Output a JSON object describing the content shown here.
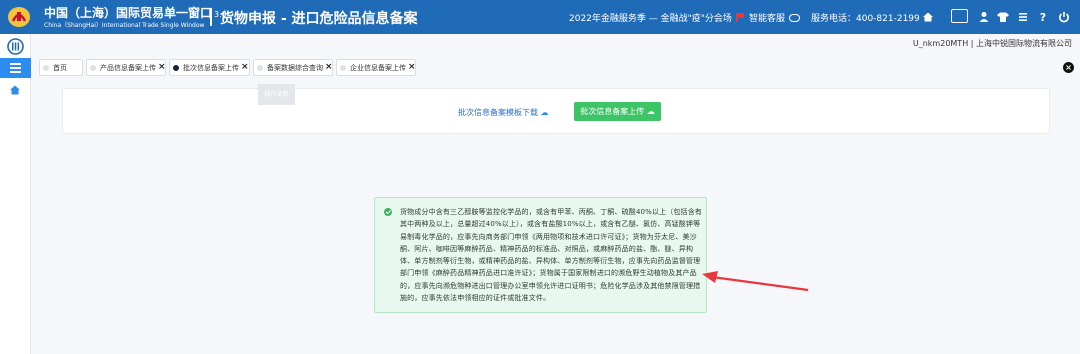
{
  "header": {
    "brand_cn": "中国（上海）国际贸易单一窗口",
    "brand_version": "3.0",
    "brand_en": "China（ShangHai）International Trade Single Window",
    "page_title": "货物申报 - 进口危险品信息备案",
    "campaign": "2022年金融服务季 — 金融战\"疫\"分会场",
    "service_label": "智能客服",
    "hotline": "服务电话：400-821-2199",
    "username": "U_nkm20MTH | 上海中锐国际物流有限公司"
  },
  "tabs": [
    {
      "label": "首页",
      "closable": false,
      "active": false
    },
    {
      "label": "产品信息备案上传",
      "closable": true,
      "active": false
    },
    {
      "label": "批次信息备案上传",
      "closable": true,
      "active": true
    },
    {
      "label": "备案数据综合查询",
      "closable": true,
      "active": false
    },
    {
      "label": "企业信息备案上传",
      "closable": true,
      "active": false
    }
  ],
  "tab_close_glyph": "×",
  "toolbar": {
    "ghost_label": "操作说明",
    "download_link": "批次信息备案模板下载",
    "upload_button": "批次信息备案上传"
  },
  "notice": {
    "text": "货物成分中含有三乙醇胺等监控化学品的，或含有甲苯、丙酮、丁酮、硫酸40%以上（包括含有其中两种及以上，总量超过40%以上），或含有盐酸10%以上，或含有乙醚、氯仿、高锰酸钾等易制毒化学品的，应事先向商务部门申领《两用物项和技术进口许可证》；货物为芬太尼、美沙酮、阿片、咖啡因等麻醉药品、精神药品的标准品、对照品，或麻醉药品的盐、酯、醚、异构体、单方制剂等衍生物，或精神药品的盐、异构体、单方制剂等衍生物，应事先向药品监督管理部门申领《麻醉药品精神药品进口准许证》；货物属于国家限制进口的濒危野生动植物及其产品的，应事先向濒危物种进出口管理办公室申领允许进口证明书；危险化学品涉及其他禁限管理措施的，应事先依法申领相应的证件或批准文件。"
  },
  "colors": {
    "header_blue": "#1f6bb8",
    "menu_blue": "#2d8cf0",
    "success_green": "#3cc466",
    "notice_bg": "#e9f8ee",
    "arrow_red": "#e8383d"
  },
  "icons": [
    "logo-icon",
    "flag-icon",
    "service-icon",
    "home-icon",
    "grid-icon",
    "user-icon",
    "tshirt-icon",
    "menu-list-icon",
    "help-icon",
    "power-icon",
    "menu-icon",
    "cloud-download-icon",
    "cloud-upload-icon",
    "check-circle-icon",
    "close-circle-icon"
  ]
}
